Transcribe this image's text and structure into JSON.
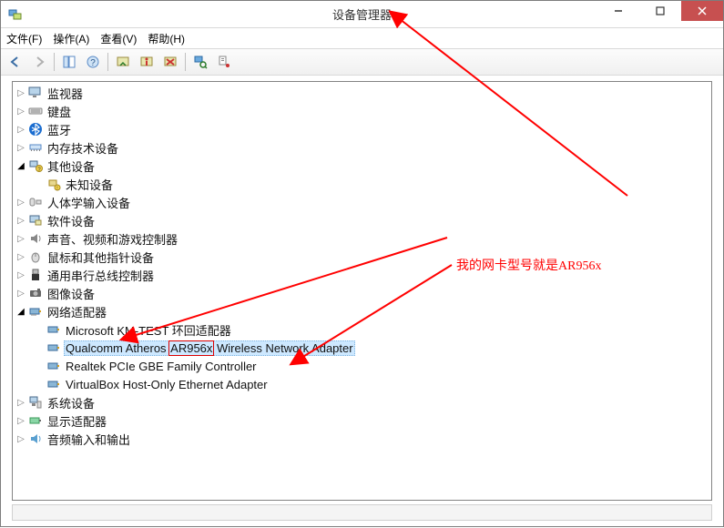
{
  "window": {
    "title": "设备管理器"
  },
  "menu": {
    "file": "文件(F)",
    "action": "操作(A)",
    "view": "查看(V)",
    "help": "帮助(H)"
  },
  "toolbar": {
    "back": "后退",
    "forward": "前进",
    "showhide": "显示/隐藏控制台树",
    "help": "帮助",
    "update": "更新驱动",
    "disable": "禁用",
    "uninstall": "卸载",
    "scan": "扫描检测硬件改动",
    "properties": "属性"
  },
  "tree": {
    "items": [
      {
        "label": "监视器"
      },
      {
        "label": "键盘"
      },
      {
        "label": "蓝牙"
      },
      {
        "label": "内存技术设备"
      },
      {
        "label": "其他设备"
      },
      {
        "label": "人体学输入设备"
      },
      {
        "label": "软件设备"
      },
      {
        "label": "声音、视频和游戏控制器"
      },
      {
        "label": "鼠标和其他指针设备"
      },
      {
        "label": "通用串行总线控制器"
      },
      {
        "label": "图像设备"
      },
      {
        "label": "网络适配器"
      },
      {
        "label": "系统设备"
      },
      {
        "label": "显示适配器"
      },
      {
        "label": "音频输入和输出"
      }
    ],
    "otherDevice": {
      "label": "未知设备"
    },
    "netAdapters": [
      {
        "label": "Microsoft KM-TEST 环回适配器"
      },
      {
        "label": "Qualcomm Atheros AR956x Wireless Network Adapter",
        "parts": {
          "pre": "Qualcomm Atheros ",
          "box": "AR956x",
          "post": " Wireless Network Adapter"
        },
        "selected": true
      },
      {
        "label": "Realtek PCIe GBE Family Controller"
      },
      {
        "label": "VirtualBox Host-Only Ethernet Adapter"
      }
    ]
  },
  "annotation": {
    "text": "我的网卡型号就是AR956x"
  }
}
